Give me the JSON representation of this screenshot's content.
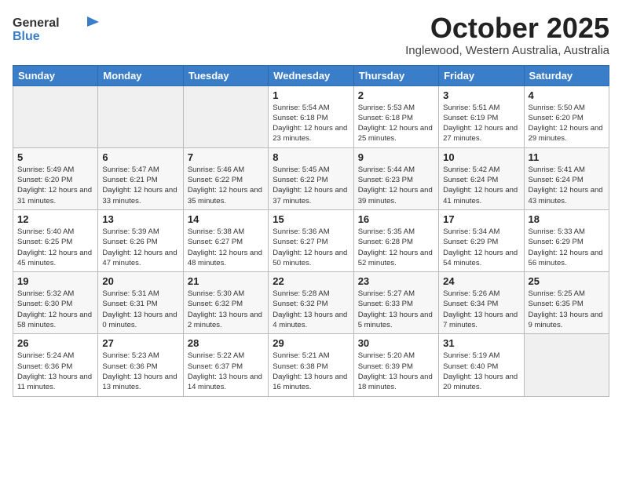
{
  "header": {
    "logo_line1": "General",
    "logo_line2": "Blue",
    "month_title": "October 2025",
    "subtitle": "Inglewood, Western Australia, Australia"
  },
  "weekdays": [
    "Sunday",
    "Monday",
    "Tuesday",
    "Wednesday",
    "Thursday",
    "Friday",
    "Saturday"
  ],
  "weeks": [
    [
      {
        "day": "",
        "empty": true
      },
      {
        "day": "",
        "empty": true
      },
      {
        "day": "",
        "empty": true
      },
      {
        "day": "1",
        "sunrise": "Sunrise: 5:54 AM",
        "sunset": "Sunset: 6:18 PM",
        "daylight": "Daylight: 12 hours and 23 minutes."
      },
      {
        "day": "2",
        "sunrise": "Sunrise: 5:53 AM",
        "sunset": "Sunset: 6:18 PM",
        "daylight": "Daylight: 12 hours and 25 minutes."
      },
      {
        "day": "3",
        "sunrise": "Sunrise: 5:51 AM",
        "sunset": "Sunset: 6:19 PM",
        "daylight": "Daylight: 12 hours and 27 minutes."
      },
      {
        "day": "4",
        "sunrise": "Sunrise: 5:50 AM",
        "sunset": "Sunset: 6:20 PM",
        "daylight": "Daylight: 12 hours and 29 minutes."
      }
    ],
    [
      {
        "day": "5",
        "sunrise": "Sunrise: 5:49 AM",
        "sunset": "Sunset: 6:20 PM",
        "daylight": "Daylight: 12 hours and 31 minutes."
      },
      {
        "day": "6",
        "sunrise": "Sunrise: 5:47 AM",
        "sunset": "Sunset: 6:21 PM",
        "daylight": "Daylight: 12 hours and 33 minutes."
      },
      {
        "day": "7",
        "sunrise": "Sunrise: 5:46 AM",
        "sunset": "Sunset: 6:22 PM",
        "daylight": "Daylight: 12 hours and 35 minutes."
      },
      {
        "day": "8",
        "sunrise": "Sunrise: 5:45 AM",
        "sunset": "Sunset: 6:22 PM",
        "daylight": "Daylight: 12 hours and 37 minutes."
      },
      {
        "day": "9",
        "sunrise": "Sunrise: 5:44 AM",
        "sunset": "Sunset: 6:23 PM",
        "daylight": "Daylight: 12 hours and 39 minutes."
      },
      {
        "day": "10",
        "sunrise": "Sunrise: 5:42 AM",
        "sunset": "Sunset: 6:24 PM",
        "daylight": "Daylight: 12 hours and 41 minutes."
      },
      {
        "day": "11",
        "sunrise": "Sunrise: 5:41 AM",
        "sunset": "Sunset: 6:24 PM",
        "daylight": "Daylight: 12 hours and 43 minutes."
      }
    ],
    [
      {
        "day": "12",
        "sunrise": "Sunrise: 5:40 AM",
        "sunset": "Sunset: 6:25 PM",
        "daylight": "Daylight: 12 hours and 45 minutes."
      },
      {
        "day": "13",
        "sunrise": "Sunrise: 5:39 AM",
        "sunset": "Sunset: 6:26 PM",
        "daylight": "Daylight: 12 hours and 47 minutes."
      },
      {
        "day": "14",
        "sunrise": "Sunrise: 5:38 AM",
        "sunset": "Sunset: 6:27 PM",
        "daylight": "Daylight: 12 hours and 48 minutes."
      },
      {
        "day": "15",
        "sunrise": "Sunrise: 5:36 AM",
        "sunset": "Sunset: 6:27 PM",
        "daylight": "Daylight: 12 hours and 50 minutes."
      },
      {
        "day": "16",
        "sunrise": "Sunrise: 5:35 AM",
        "sunset": "Sunset: 6:28 PM",
        "daylight": "Daylight: 12 hours and 52 minutes."
      },
      {
        "day": "17",
        "sunrise": "Sunrise: 5:34 AM",
        "sunset": "Sunset: 6:29 PM",
        "daylight": "Daylight: 12 hours and 54 minutes."
      },
      {
        "day": "18",
        "sunrise": "Sunrise: 5:33 AM",
        "sunset": "Sunset: 6:29 PM",
        "daylight": "Daylight: 12 hours and 56 minutes."
      }
    ],
    [
      {
        "day": "19",
        "sunrise": "Sunrise: 5:32 AM",
        "sunset": "Sunset: 6:30 PM",
        "daylight": "Daylight: 12 hours and 58 minutes."
      },
      {
        "day": "20",
        "sunrise": "Sunrise: 5:31 AM",
        "sunset": "Sunset: 6:31 PM",
        "daylight": "Daylight: 13 hours and 0 minutes."
      },
      {
        "day": "21",
        "sunrise": "Sunrise: 5:30 AM",
        "sunset": "Sunset: 6:32 PM",
        "daylight": "Daylight: 13 hours and 2 minutes."
      },
      {
        "day": "22",
        "sunrise": "Sunrise: 5:28 AM",
        "sunset": "Sunset: 6:32 PM",
        "daylight": "Daylight: 13 hours and 4 minutes."
      },
      {
        "day": "23",
        "sunrise": "Sunrise: 5:27 AM",
        "sunset": "Sunset: 6:33 PM",
        "daylight": "Daylight: 13 hours and 5 minutes."
      },
      {
        "day": "24",
        "sunrise": "Sunrise: 5:26 AM",
        "sunset": "Sunset: 6:34 PM",
        "daylight": "Daylight: 13 hours and 7 minutes."
      },
      {
        "day": "25",
        "sunrise": "Sunrise: 5:25 AM",
        "sunset": "Sunset: 6:35 PM",
        "daylight": "Daylight: 13 hours and 9 minutes."
      }
    ],
    [
      {
        "day": "26",
        "sunrise": "Sunrise: 5:24 AM",
        "sunset": "Sunset: 6:36 PM",
        "daylight": "Daylight: 13 hours and 11 minutes."
      },
      {
        "day": "27",
        "sunrise": "Sunrise: 5:23 AM",
        "sunset": "Sunset: 6:36 PM",
        "daylight": "Daylight: 13 hours and 13 minutes."
      },
      {
        "day": "28",
        "sunrise": "Sunrise: 5:22 AM",
        "sunset": "Sunset: 6:37 PM",
        "daylight": "Daylight: 13 hours and 14 minutes."
      },
      {
        "day": "29",
        "sunrise": "Sunrise: 5:21 AM",
        "sunset": "Sunset: 6:38 PM",
        "daylight": "Daylight: 13 hours and 16 minutes."
      },
      {
        "day": "30",
        "sunrise": "Sunrise: 5:20 AM",
        "sunset": "Sunset: 6:39 PM",
        "daylight": "Daylight: 13 hours and 18 minutes."
      },
      {
        "day": "31",
        "sunrise": "Sunrise: 5:19 AM",
        "sunset": "Sunset: 6:40 PM",
        "daylight": "Daylight: 13 hours and 20 minutes."
      },
      {
        "day": "",
        "empty": true
      }
    ]
  ]
}
